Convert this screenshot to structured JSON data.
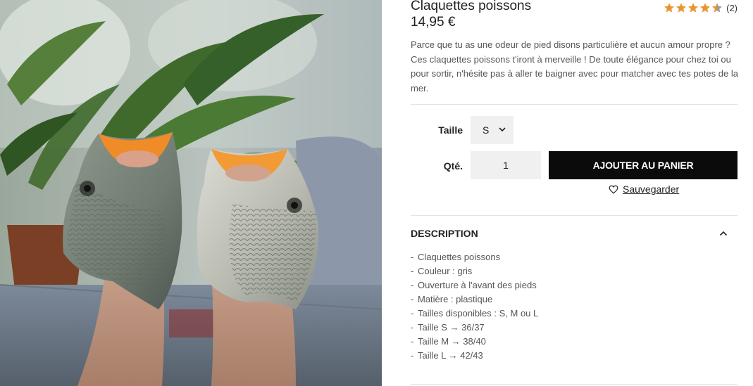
{
  "product": {
    "title": "Claquettes poissons",
    "price": "14,95 €",
    "rating": {
      "stars": 4,
      "max": 5,
      "count_label": "(2)"
    },
    "description": "Parce que tu as une odeur de pied disons particulière et aucun amour propre ? Ces claquettes poissons t'iront à merveille ! De toute élégance pour chez toi ou pour sortir,  n'hésite pas à aller te baigner avec pour matcher avec tes potes de la mer."
  },
  "form": {
    "size_label": "Taille",
    "size_value": "S",
    "qty_label": "Qté.",
    "qty_value": "1",
    "add_to_cart_label": "AJOUTER AU PANIER",
    "save_label": "Sauvegarder"
  },
  "accordion": {
    "title": "DESCRIPTION",
    "items": [
      "Claquettes poissons",
      "Couleur : gris",
      "Ouverture à l'avant des pieds",
      "Matière : plastique",
      "Tailles disponibles : S, M ou L",
      "Taille S → 36/37",
      "Taille M → 38/40",
      "Taille L → 42/43"
    ]
  },
  "colors": {
    "star": "#e8962c",
    "star_empty": "#9a9a9a",
    "button_bg": "#0b0b0b",
    "field_bg": "#f0f0f0"
  },
  "icons": {
    "rating": "star-icon",
    "select": "chevron-down-icon",
    "save": "heart-icon",
    "accordion": "chevron-up-icon"
  }
}
